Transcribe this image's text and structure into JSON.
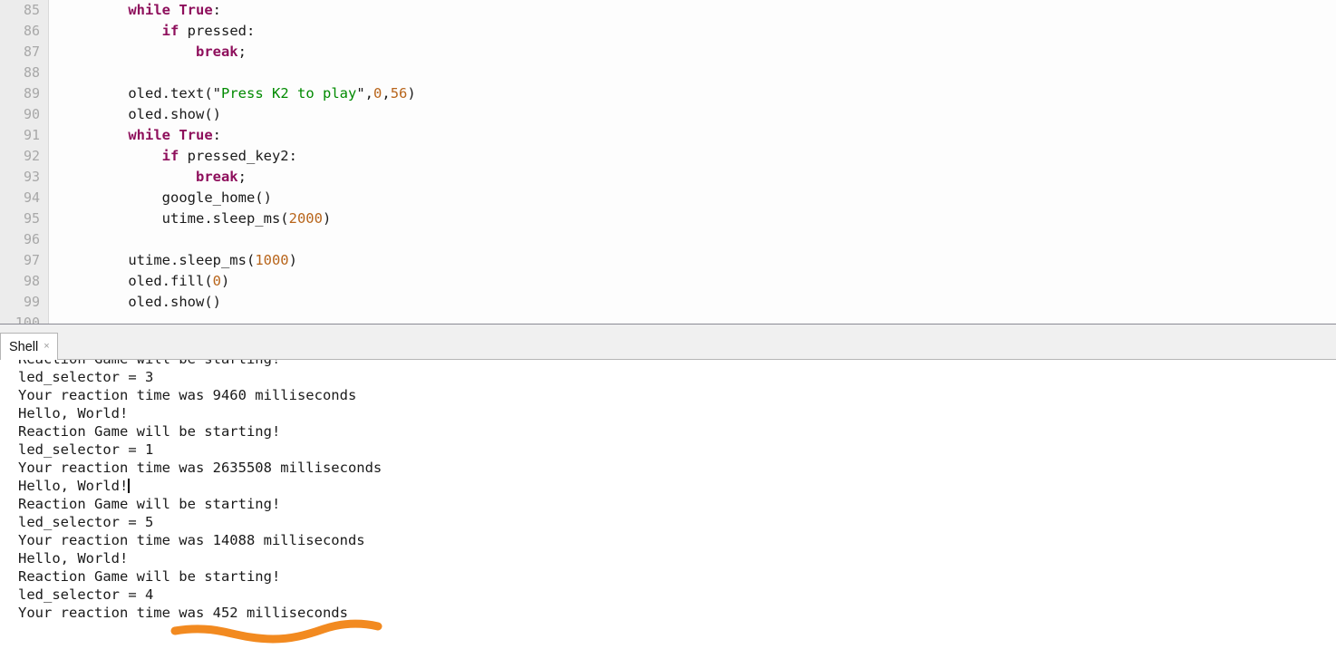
{
  "editor": {
    "first_line_number": 85,
    "line_numbers": [
      85,
      86,
      87,
      88,
      89,
      90,
      91,
      92,
      93,
      94,
      95,
      96,
      97,
      98,
      99
    ],
    "lines": [
      {
        "number": "85",
        "tokens": [
          {
            "t": "    ",
            "c": "pl"
          },
          {
            "t": "while",
            "c": "kw"
          },
          {
            "t": " ",
            "c": "pl"
          },
          {
            "t": "True",
            "c": "bool"
          },
          {
            "t": ":",
            "c": "pl"
          }
        ]
      },
      {
        "number": "86",
        "tokens": [
          {
            "t": "        ",
            "c": "pl"
          },
          {
            "t": "if",
            "c": "kw"
          },
          {
            "t": " pressed:",
            "c": "pl"
          }
        ]
      },
      {
        "number": "87",
        "tokens": [
          {
            "t": "            ",
            "c": "pl"
          },
          {
            "t": "break",
            "c": "kw"
          },
          {
            "t": ";",
            "c": "pl"
          }
        ]
      },
      {
        "number": "88",
        "tokens": [
          {
            "t": "",
            "c": "pl"
          }
        ]
      },
      {
        "number": "89",
        "tokens": [
          {
            "t": "    oled.text(",
            "c": "pl"
          },
          {
            "t": "\"",
            "c": "q"
          },
          {
            "t": "Press K2 to play",
            "c": "str"
          },
          {
            "t": "\"",
            "c": "q"
          },
          {
            "t": ",",
            "c": "pl"
          },
          {
            "t": "0",
            "c": "num"
          },
          {
            "t": ",",
            "c": "pl"
          },
          {
            "t": "56",
            "c": "num"
          },
          {
            "t": ")",
            "c": "pl"
          }
        ]
      },
      {
        "number": "90",
        "tokens": [
          {
            "t": "    oled.show()",
            "c": "pl"
          }
        ]
      },
      {
        "number": "91",
        "tokens": [
          {
            "t": "    ",
            "c": "pl"
          },
          {
            "t": "while",
            "c": "kw"
          },
          {
            "t": " ",
            "c": "pl"
          },
          {
            "t": "True",
            "c": "bool"
          },
          {
            "t": ":",
            "c": "pl"
          }
        ]
      },
      {
        "number": "92",
        "tokens": [
          {
            "t": "        ",
            "c": "pl"
          },
          {
            "t": "if",
            "c": "kw"
          },
          {
            "t": " pressed_key2:",
            "c": "pl"
          }
        ]
      },
      {
        "number": "93",
        "tokens": [
          {
            "t": "            ",
            "c": "pl"
          },
          {
            "t": "break",
            "c": "kw"
          },
          {
            "t": ";",
            "c": "pl"
          }
        ]
      },
      {
        "number": "94",
        "tokens": [
          {
            "t": "        google_home()",
            "c": "pl"
          }
        ]
      },
      {
        "number": "95",
        "tokens": [
          {
            "t": "        utime.sleep_ms(",
            "c": "pl"
          },
          {
            "t": "2000",
            "c": "num"
          },
          {
            "t": ")",
            "c": "pl"
          }
        ]
      },
      {
        "number": "96",
        "tokens": [
          {
            "t": "",
            "c": "pl"
          }
        ]
      },
      {
        "number": "97",
        "tokens": [
          {
            "t": "    utime.sleep_ms(",
            "c": "pl"
          },
          {
            "t": "1000",
            "c": "num"
          },
          {
            "t": ")",
            "c": "pl"
          }
        ]
      },
      {
        "number": "98",
        "tokens": [
          {
            "t": "    oled.fill(",
            "c": "pl"
          },
          {
            "t": "0",
            "c": "num"
          },
          {
            "t": ")",
            "c": "pl"
          }
        ]
      },
      {
        "number": "99",
        "tokens": [
          {
            "t": "    oled.show()",
            "c": "pl"
          }
        ]
      }
    ]
  },
  "tabbar": {
    "tabs": [
      {
        "label": "Shell",
        "close_glyph": "×",
        "active": true
      }
    ]
  },
  "shell": {
    "lines": [
      {
        "text": "Reaction Game will be starting!",
        "clipped": true,
        "caret": false
      },
      {
        "text": "led_selector = 3",
        "clipped": false,
        "caret": false
      },
      {
        "text": "Your reaction time was 9460 milliseconds",
        "clipped": false,
        "caret": false
      },
      {
        "text": "Hello, World!",
        "clipped": false,
        "caret": false
      },
      {
        "text": "Reaction Game will be starting!",
        "clipped": false,
        "caret": false
      },
      {
        "text": "led_selector = 1",
        "clipped": false,
        "caret": false
      },
      {
        "text": "Your reaction time was 2635508 milliseconds",
        "clipped": false,
        "caret": false
      },
      {
        "text": "Hello, World!",
        "clipped": false,
        "caret": true
      },
      {
        "text": "Reaction Game will be starting!",
        "clipped": false,
        "caret": false
      },
      {
        "text": "led_selector = 5",
        "clipped": false,
        "caret": false
      },
      {
        "text": "Your reaction time was 14088 milliseconds",
        "clipped": false,
        "caret": false
      },
      {
        "text": "Hello, World!",
        "clipped": false,
        "caret": false
      },
      {
        "text": "Reaction Game will be starting!",
        "clipped": false,
        "caret": false
      },
      {
        "text": "led_selector = 4",
        "clipped": false,
        "caret": false
      },
      {
        "text": "Your reaction time was 452 milliseconds",
        "clipped": false,
        "caret": false
      }
    ]
  },
  "annotation": {
    "type": "hand-drawn-squiggle-underline",
    "color": "#F28A20",
    "stroke_width": 9,
    "targets_text": "Your reaction time was 452 milliseconds"
  },
  "colors": {
    "editor_bg": "#fdfdfd",
    "gutter_bg": "#ececec",
    "gutter_text": "#a8a8a8",
    "code_text": "#1a1a1a",
    "keyword": "#8e0f5c",
    "string": "#008a00",
    "number": "#b8651b",
    "shell_bg": "#ffffff",
    "shell_text": "#1a1a1a",
    "tabbar_bg": "#f0f0f0",
    "tab_active_bg": "#ffffff",
    "annotation": "#F28A20"
  }
}
